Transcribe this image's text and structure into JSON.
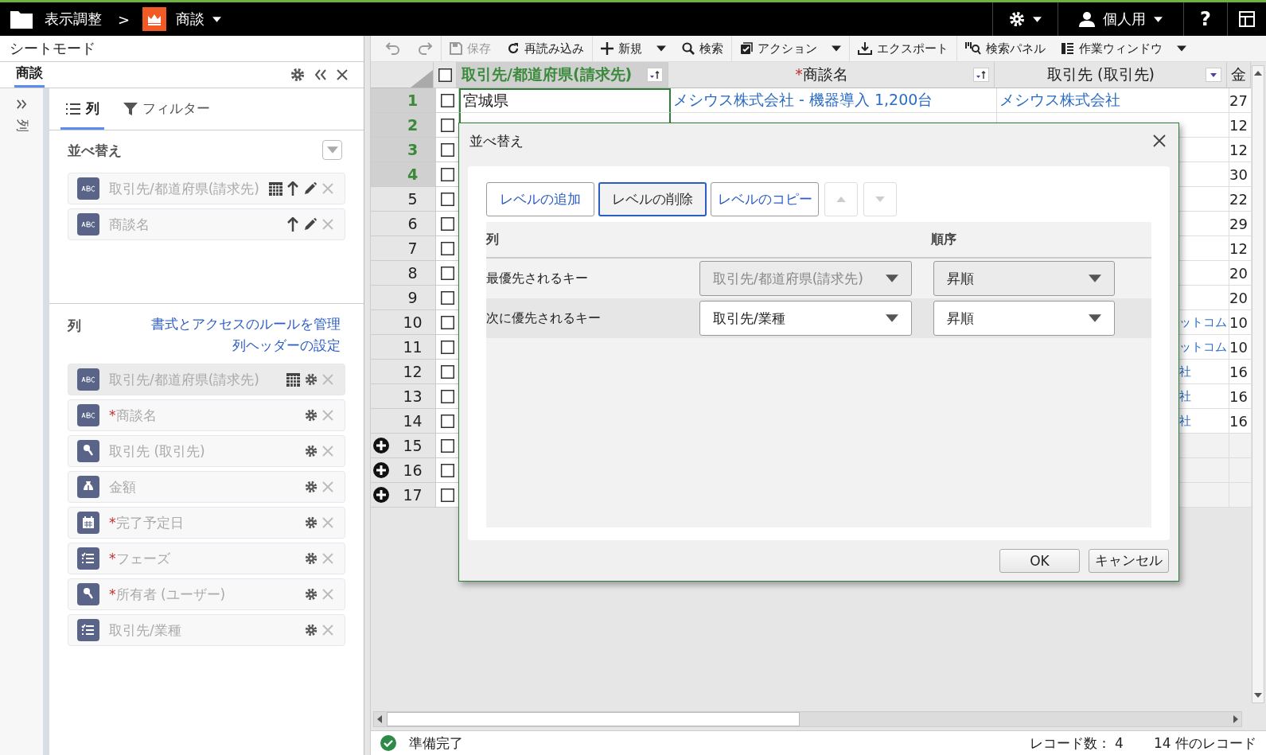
{
  "top_bar": {
    "breadcrumb": "表示調整",
    "separator": ">",
    "module": "商談",
    "user": "個人用",
    "help": "?"
  },
  "side_panel": {
    "title": "シートモード",
    "tab": {
      "label": "商談",
      "selected": true
    },
    "collapsed_label": "列",
    "subtabs": [
      {
        "label": "列",
        "kind": "list",
        "selected": true
      },
      {
        "label": "フィルター",
        "kind": "filter",
        "selected": false
      }
    ],
    "sort": {
      "heading": "並べ替え",
      "items": [
        {
          "label": "取引先/都道府県(請求先)",
          "kind": "text",
          "grid": true
        },
        {
          "label": "商談名",
          "kind": "text",
          "grid": false
        }
      ]
    },
    "columns": {
      "heading": "列",
      "links": [
        "書式とアクセスのルールを管理",
        "列ヘッダーの設定"
      ],
      "items": [
        {
          "label": "取引先/都道府県(請求先)",
          "kind": "text",
          "grid": true,
          "selected": true
        },
        {
          "label": "商談名",
          "kind": "text",
          "required_mark": "*",
          "grid": false,
          "selected": false
        },
        {
          "label": "取引先 (取引先)",
          "kind": "lookup",
          "grid": false,
          "selected": false
        },
        {
          "label": "金額",
          "kind": "currency",
          "grid": false,
          "selected": false
        },
        {
          "label": "完了予定日",
          "kind": "date",
          "required_mark": "*",
          "grid": false,
          "selected": false
        },
        {
          "label": "フェーズ",
          "kind": "picklist",
          "required_mark": "*",
          "grid": false,
          "selected": false
        },
        {
          "label": "所有者 (ユーザー)",
          "kind": "lookup",
          "required_mark": "*",
          "grid": false,
          "selected": false
        },
        {
          "label": "取引先/業種",
          "kind": "picklist",
          "grid": false,
          "selected": false
        }
      ]
    }
  },
  "toolbar": [
    {
      "kind": "undo",
      "disabled": true
    },
    {
      "kind": "redo",
      "disabled": true
    },
    {
      "kind": "save",
      "label": "保存",
      "disabled": true
    },
    {
      "kind": "reload",
      "label": "再読み込み",
      "disabled": false
    },
    {
      "kind": "new",
      "label": "新規",
      "disabled": false,
      "menu": true
    },
    {
      "kind": "search",
      "label": "検索",
      "disabled": false
    },
    {
      "kind": "action",
      "label": "アクション",
      "disabled": false,
      "menu": true
    },
    {
      "kind": "export",
      "label": "エクスポート",
      "disabled": false
    },
    {
      "kind": "search_panel",
      "label": "検索パネル",
      "disabled": false
    },
    {
      "kind": "work_window",
      "label": "作業ウィンドウ",
      "disabled": false,
      "menu": true
    }
  ],
  "grid": {
    "select_all_checked": false,
    "columns": [
      {
        "label": "取引先/都道府県(請求先)",
        "kind": "sorted"
      },
      {
        "label": "商談名",
        "required_mark": "*",
        "kind": "sorted"
      },
      {
        "label": "取引先 (取引先)",
        "kind": "filter"
      },
      {
        "label": "金",
        "kind": "plain"
      }
    ],
    "rows": [
      {
        "number": "1",
        "selected": true,
        "checked": false,
        "kind": "record",
        "cells": [
          "宮城県",
          "メシウス株式会社 - 機器導入 1,200台",
          "メシウス株式会社",
          "27"
        ]
      },
      {
        "number": "2",
        "selected": true,
        "checked": false,
        "kind": "record",
        "cells": [
          null,
          null,
          null,
          "12"
        ]
      },
      {
        "number": "3",
        "selected": true,
        "checked": false,
        "kind": "record",
        "cells": [
          null,
          null,
          null,
          "12"
        ]
      },
      {
        "number": "4",
        "selected": true,
        "checked": false,
        "kind": "record",
        "cells": [
          null,
          null,
          null,
          "30"
        ]
      },
      {
        "number": "5",
        "selected": false,
        "checked": false,
        "kind": "record",
        "cells": [
          null,
          null,
          null,
          "22"
        ]
      },
      {
        "number": "6",
        "selected": false,
        "checked": false,
        "kind": "record",
        "cells": [
          null,
          null,
          null,
          "29"
        ]
      },
      {
        "number": "7",
        "selected": false,
        "checked": false,
        "kind": "record",
        "cells": [
          null,
          null,
          null,
          "12"
        ]
      },
      {
        "number": "8",
        "selected": false,
        "checked": false,
        "kind": "record",
        "cells": [
          null,
          null,
          null,
          "20"
        ]
      },
      {
        "number": "9",
        "selected": false,
        "checked": false,
        "kind": "record",
        "cells": [
          null,
          null,
          null,
          "20"
        ]
      },
      {
        "number": "10",
        "selected": false,
        "checked": false,
        "kind": "record",
        "cells": [
          null,
          null,
          "ットコム",
          "10"
        ]
      },
      {
        "number": "11",
        "selected": false,
        "checked": false,
        "kind": "record",
        "cells": [
          null,
          null,
          "ットコム",
          "10"
        ]
      },
      {
        "number": "12",
        "selected": false,
        "checked": false,
        "kind": "record",
        "cells": [
          null,
          null,
          "社",
          "16"
        ]
      },
      {
        "number": "13",
        "selected": false,
        "checked": false,
        "kind": "record",
        "cells": [
          null,
          null,
          "社",
          "16"
        ]
      },
      {
        "number": "14",
        "selected": false,
        "checked": false,
        "kind": "record",
        "cells": [
          null,
          null,
          "社",
          "16"
        ]
      },
      {
        "number": "15",
        "selected": false,
        "checked": false,
        "kind": "new",
        "cells": [
          null,
          null,
          null,
          null
        ]
      },
      {
        "number": "16",
        "selected": false,
        "checked": false,
        "kind": "new",
        "cells": [
          null,
          null,
          null,
          null
        ]
      },
      {
        "number": "17",
        "selected": false,
        "checked": false,
        "kind": "new",
        "cells": [
          null,
          null,
          null,
          null
        ]
      }
    ]
  },
  "dialog": {
    "title": "並べ替え",
    "buttons": [
      {
        "label": "レベルの追加",
        "focused": false
      },
      {
        "label": "レベルの削除",
        "focused": true
      },
      {
        "label": "レベルのコピー",
        "focused": false
      }
    ],
    "move_buttons": [
      {
        "kind": "up",
        "disabled": true
      },
      {
        "kind": "down",
        "disabled": true
      }
    ],
    "headers": [
      "列",
      "順序"
    ],
    "levels": [
      {
        "label": "最優先されるキー",
        "column": "取引先/都道府県(請求先)",
        "order": "昇順",
        "disabled": true,
        "selected": false
      },
      {
        "label": "次に優先されるキー",
        "column": "取引先/業種",
        "order": "昇順",
        "disabled": false,
        "selected": true
      }
    ],
    "ok": "OK",
    "cancel": "キャンセル"
  },
  "status_bar": {
    "status": "準備完了",
    "record_count": "レコード数： 4",
    "total": "14 件のレコード"
  }
}
